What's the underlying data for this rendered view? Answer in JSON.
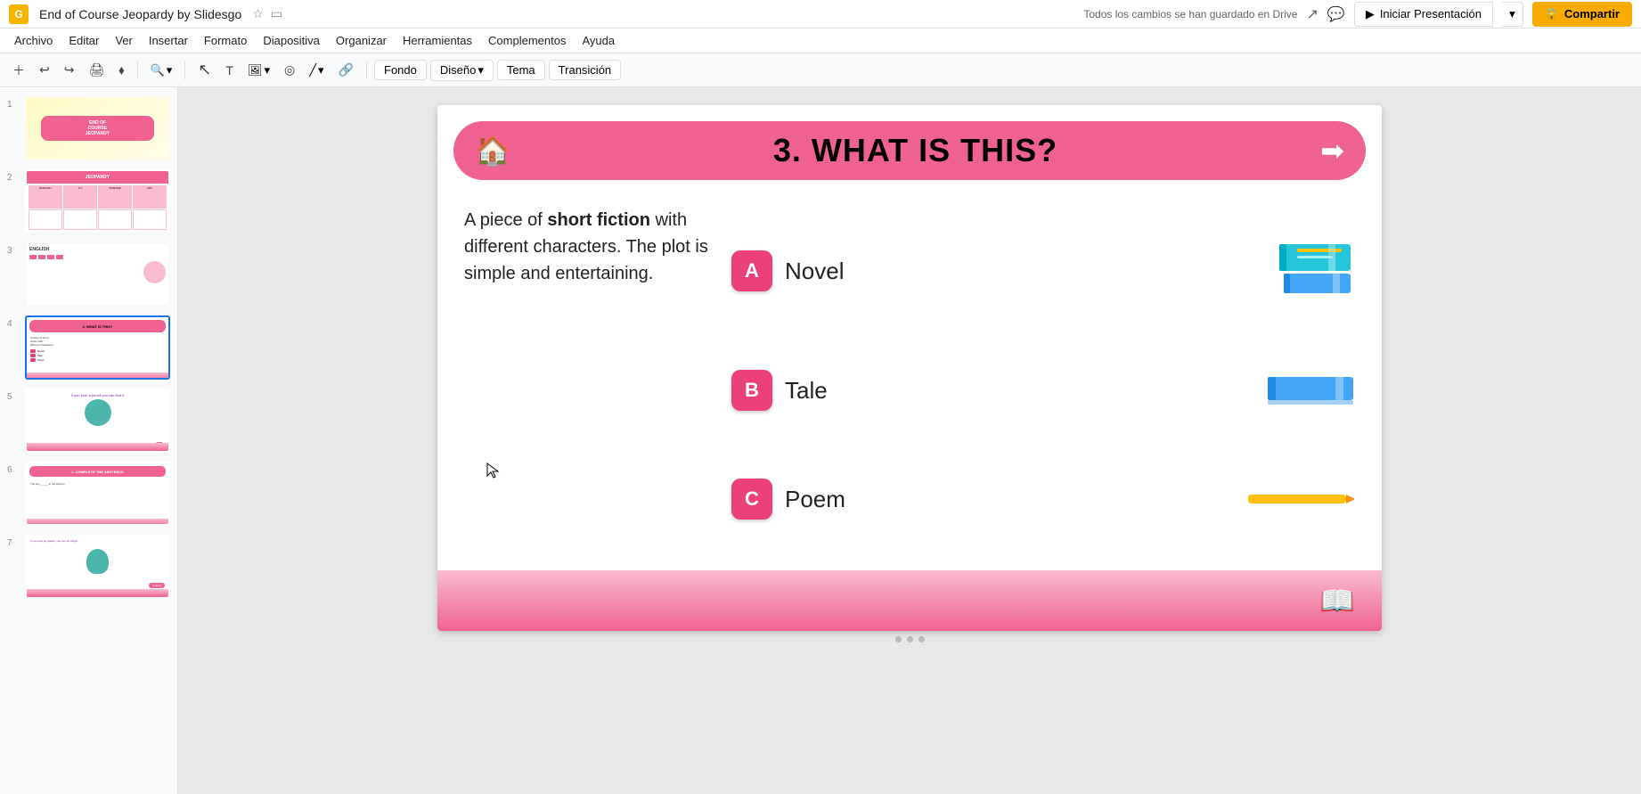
{
  "app": {
    "icon_label": "G",
    "title": "End of Course Jeopardy by Slidesgo",
    "autosave": "Todos los cambios se han guardado en Drive"
  },
  "menu": {
    "items": [
      "Archivo",
      "Editar",
      "Ver",
      "Insertar",
      "Formato",
      "Diapositiva",
      "Organizar",
      "Herramientas",
      "Complementos",
      "Ayuda"
    ]
  },
  "toolbar": {
    "fondo": "Fondo",
    "diseno": "Diseño",
    "tema": "Tema",
    "transicion": "Transición"
  },
  "header_buttons": {
    "present": "Iniciar Presentación",
    "share": "Compartir"
  },
  "slide": {
    "header_title": "3. WHAT IS THIS?",
    "question": "A piece of short fiction with different characters. The plot is simple and entertaining.",
    "question_bold_parts": "short fiction",
    "answers": [
      {
        "letter": "A",
        "text": "Novel"
      },
      {
        "letter": "B",
        "text": "Tale"
      },
      {
        "letter": "C",
        "text": "Poem"
      }
    ]
  },
  "thumbnails": [
    {
      "num": "1"
    },
    {
      "num": "2"
    },
    {
      "num": "3"
    },
    {
      "num": "4"
    },
    {
      "num": "5"
    },
    {
      "num": "6"
    },
    {
      "num": "7"
    }
  ]
}
